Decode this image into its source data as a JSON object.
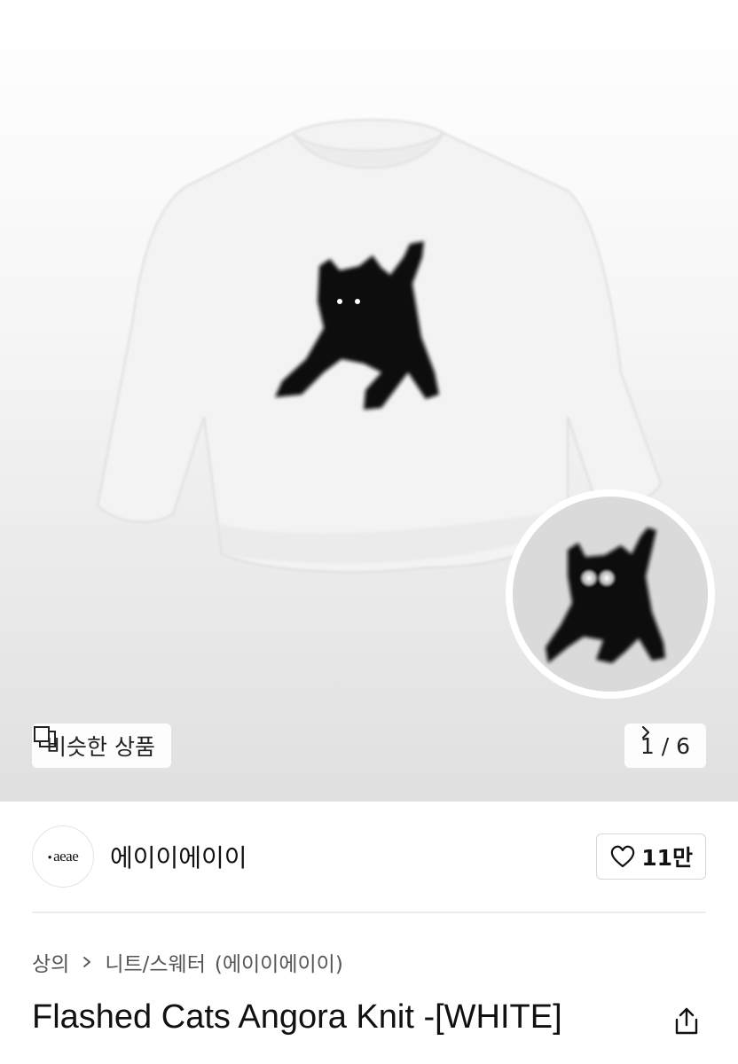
{
  "similar_button": {
    "label": "비슷한 상품",
    "icon": "overlap-squares-icon"
  },
  "gallery": {
    "current": "1",
    "total": "6",
    "label": "1 / 6",
    "icon": "chevron-right-icon"
  },
  "shop": {
    "logo_text": "aeae",
    "name": "에이이에이이"
  },
  "like": {
    "count": "11만",
    "icon": "heart-outline-icon"
  },
  "breadcrumb": {
    "category": "상의",
    "subcategory": "니트/스웨터",
    "brand": "(에이이에이이)"
  },
  "product": {
    "title": "Flashed Cats Angora Knit -[WHITE]"
  },
  "share": {
    "icon": "share-icon"
  }
}
